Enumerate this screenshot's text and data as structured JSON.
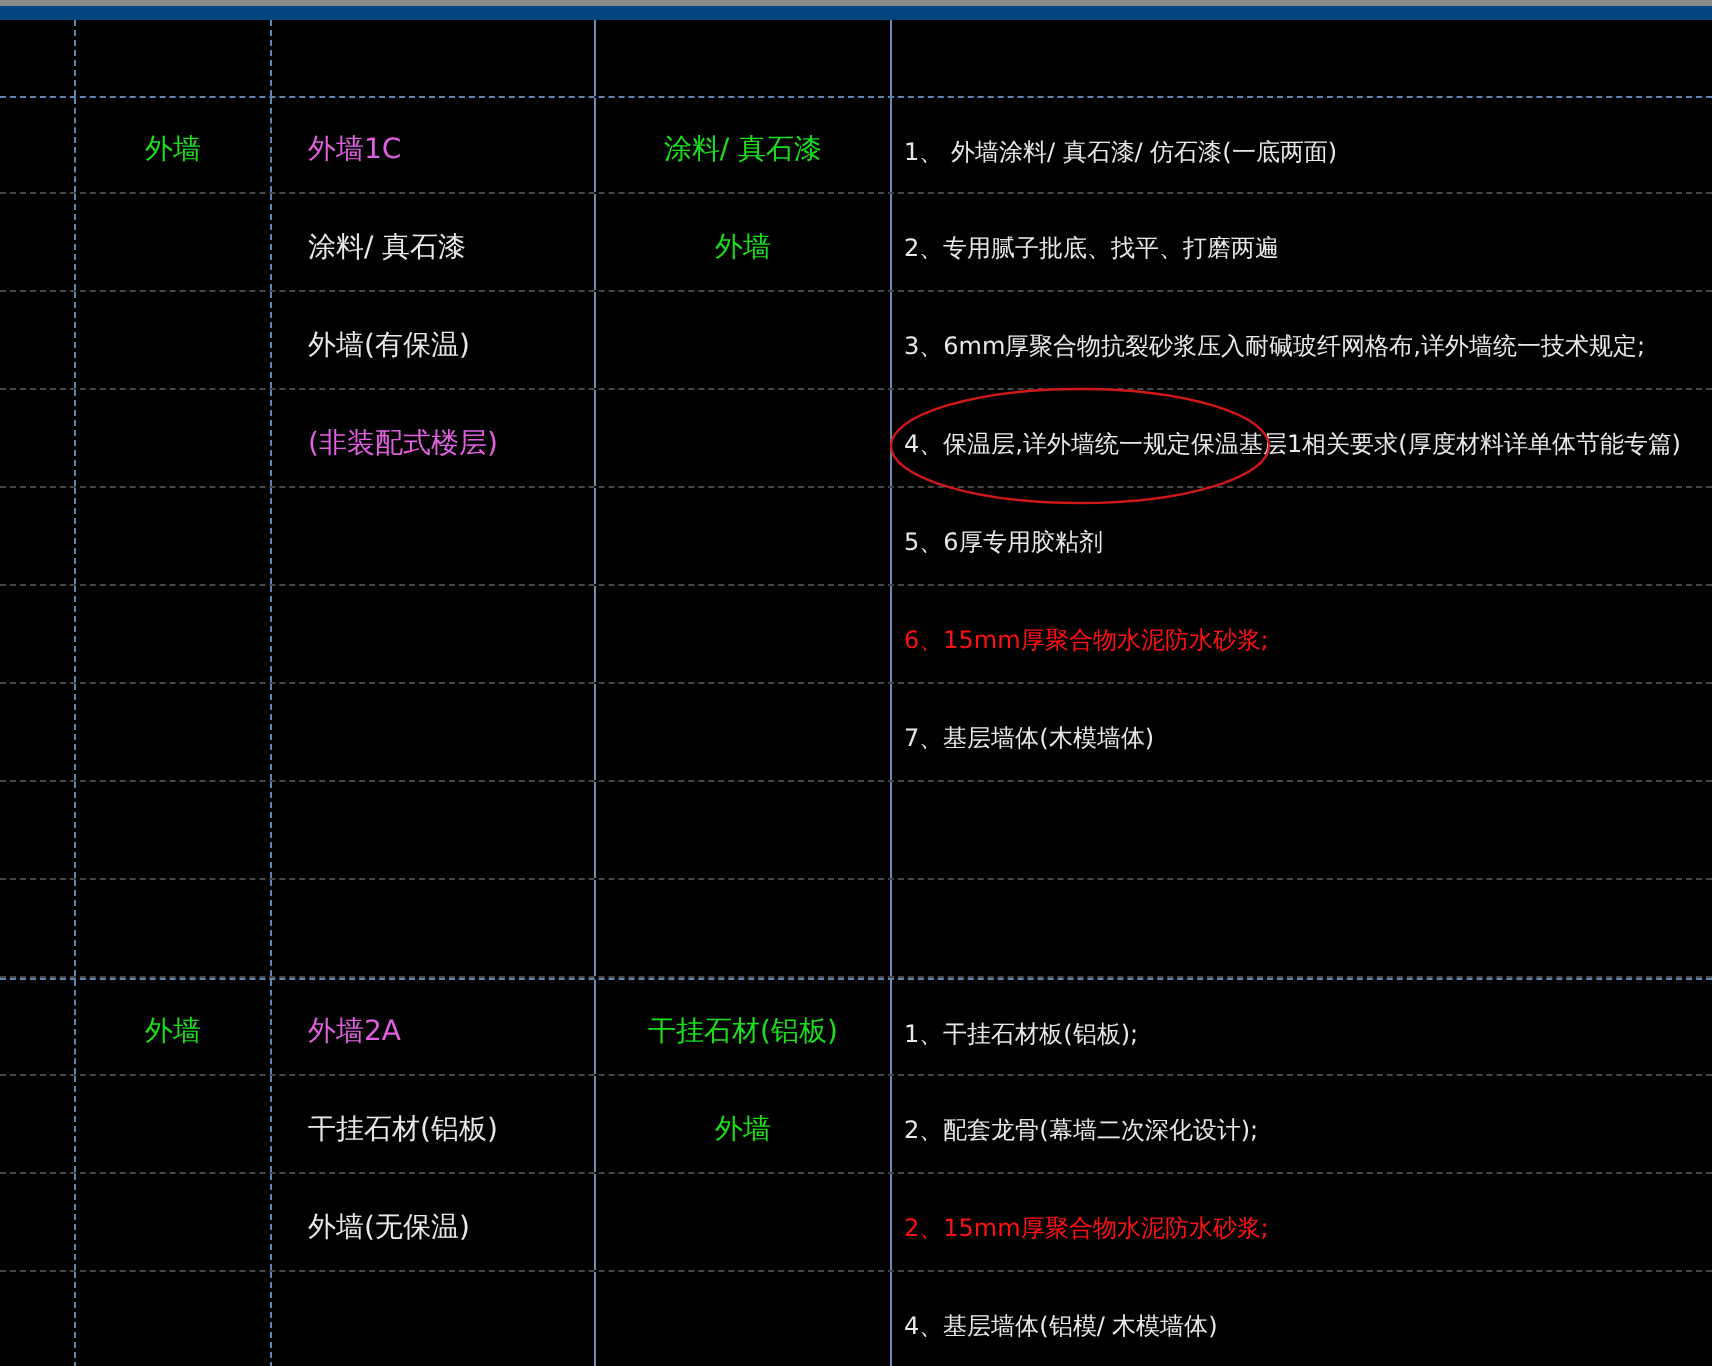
{
  "groups": [
    {
      "category": {
        "text": "外墙",
        "color": "#19e019"
      },
      "names": [
        {
          "text": "外墙1C",
          "color": "#e060e0"
        },
        {
          "text": "涂料/ 真石漆",
          "color": "#e8e8e8"
        },
        {
          "text": "外墙(有保温)",
          "color": "#e8e8e8"
        },
        {
          "text": "(非装配式楼层)",
          "color": "#e060e0"
        }
      ],
      "finish": [
        {
          "text": "涂料/ 真石漆",
          "color": "#19e019"
        },
        {
          "text": "外墙",
          "color": "#19e019"
        }
      ],
      "layers": [
        {
          "text": "1、 外墙涂料/ 真石漆/ 仿石漆(一底两面)",
          "color": "#e8e8e8",
          "circled": false
        },
        {
          "text": "2、专用腻子批底、找平、打磨两遍",
          "color": "#e8e8e8",
          "circled": false
        },
        {
          "text": "3、6mm厚聚合物抗裂砂浆压入耐碱玻纤网格布,详外墙统一技术规定;",
          "color": "#e8e8e8",
          "circled": false
        },
        {
          "text": "4、保温层,详外墙统一规定保温基层1相关要求(厚度材料详单体节能专篇)",
          "color": "#e8e8e8",
          "circled": true
        },
        {
          "text": "5、6厚专用胶粘剂",
          "color": "#e8e8e8",
          "circled": false
        },
        {
          "text": "6、15mm厚聚合物水泥防水砂浆;",
          "color": "#ff1010",
          "circled": false
        },
        {
          "text": "7、基层墙体(木模墙体)",
          "color": "#e8e8e8",
          "circled": false
        }
      ]
    },
    {
      "category": {
        "text": "外墙",
        "color": "#19e019"
      },
      "names": [
        {
          "text": "外墙2A",
          "color": "#e060e0"
        },
        {
          "text": "干挂石材(铝板)",
          "color": "#e8e8e8"
        },
        {
          "text": "外墙(无保温)",
          "color": "#e8e8e8"
        }
      ],
      "finish": [
        {
          "text": "干挂石材(铝板)",
          "color": "#19e019"
        },
        {
          "text": "外墙",
          "color": "#19e019"
        }
      ],
      "layers": [
        {
          "text": "1、干挂石材板(铝板);",
          "color": "#e8e8e8",
          "circled": false
        },
        {
          "text": "2、配套龙骨(幕墙二次深化设计);",
          "color": "#e8e8e8",
          "circled": false
        },
        {
          "text": "2、15mm厚聚合物水泥防水砂浆;",
          "color": "#ff1010",
          "circled": false
        },
        {
          "text": "4、基层墙体(铝模/ 木模墙体)",
          "color": "#e8e8e8",
          "circled": false
        }
      ]
    }
  ]
}
